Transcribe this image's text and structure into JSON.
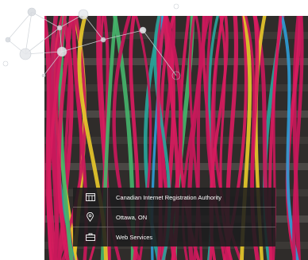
{
  "hero": {
    "image_icon": "network-cables-photo",
    "background_color": "#2f2c2a",
    "cable_colors": [
      "#d81b5e",
      "#c8185a",
      "#2aa39a",
      "#2f9bd4",
      "#e6c72a",
      "#45b36a"
    ]
  },
  "info_card": {
    "background_color": "#1c1c1e",
    "rows": [
      {
        "icon": "building-icon",
        "label": "Canadian Internet Registration Authority"
      },
      {
        "icon": "location-pin-icon",
        "label": "Ottawa, ON"
      },
      {
        "icon": "briefcase-icon",
        "label": "Web Services"
      }
    ]
  }
}
